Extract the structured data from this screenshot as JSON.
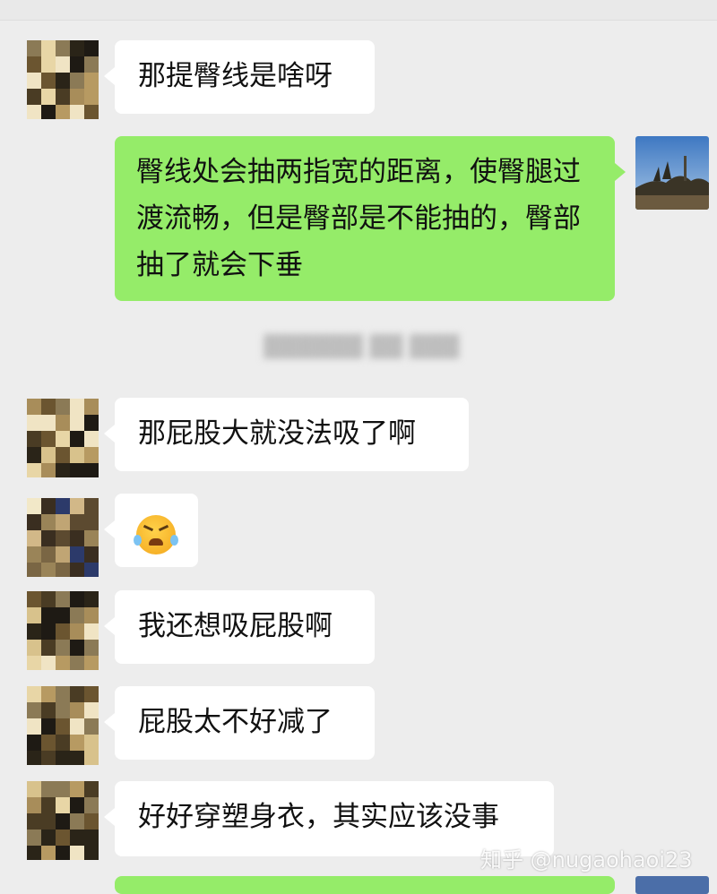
{
  "messages": {
    "m1": "那提臀线是啥呀",
    "m2": "臀线处会抽两指宽的距离，使臀腿过渡流畅，但是臀部是不能抽的，臀部抽了就会下垂",
    "m4": "那屁股大就没法吸了啊",
    "m5": "😆",
    "m6": "我还想吸屁股啊",
    "m7": "屁股太不好减了",
    "m8": "好好穿塑身衣，其实应该没事"
  },
  "system_notice": "▓▓▓▓▓▓ ▓▓ ▓▓▓",
  "watermark": "知乎 @nugaohaoi23",
  "colors": {
    "chat_bg": "#ededed",
    "incoming_bubble": "#ffffff",
    "outgoing_bubble": "#95ec69"
  }
}
